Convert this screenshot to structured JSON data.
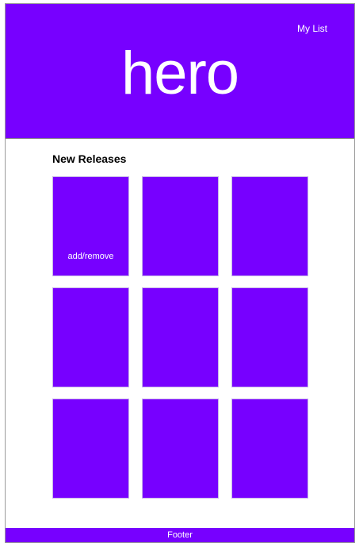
{
  "header": {
    "mylist_label": "My List",
    "hero_text": "hero"
  },
  "section": {
    "title": "New Releases"
  },
  "cards": [
    {
      "action_label": "add/remove"
    },
    {
      "action_label": ""
    },
    {
      "action_label": ""
    },
    {
      "action_label": ""
    },
    {
      "action_label": ""
    },
    {
      "action_label": ""
    },
    {
      "action_label": ""
    },
    {
      "action_label": ""
    },
    {
      "action_label": ""
    }
  ],
  "footer": {
    "label": "Footer"
  },
  "colors": {
    "accent": "#7700ff",
    "text_light": "#ffffff",
    "background": "#ffffff"
  }
}
